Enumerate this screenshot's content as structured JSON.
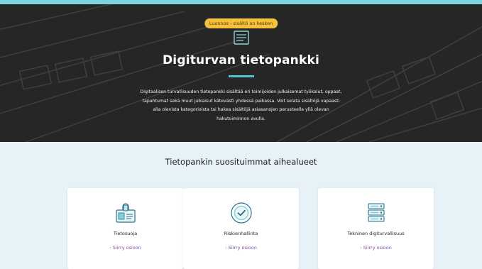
{
  "hero": {
    "badge": "Luonnos - sisältö on kesken",
    "title": "Digiturvan tietopankki",
    "description": "Digitaalisen turvallisuuden tietopankki sisältää eri toimijoiden julkaisemat työkalut, oppaat, tapahtumat sekä muut julkaisut kätevästi yhdessä paikassa. Voit selata sisältöjä vapaasti alla olevista kategorioista tai hakea sisältöjä asiasanojen perusteella yllä olevan hakutoiminnon avulla.",
    "icon": "book-icon"
  },
  "section": {
    "title": "Tietopankin suosituimmat aihealueet"
  },
  "cards": [
    {
      "title": "Tietosuoja",
      "link": "Siirry osioon",
      "icon": "id-card-lock-icon"
    },
    {
      "title": "Riskienhallinta",
      "link": "Siirry osioon",
      "icon": "shield-check-icon"
    },
    {
      "title": "Tekninen digiturvallisuus",
      "link": "Siirry osioon",
      "icon": "server-rack-icon"
    }
  ],
  "colors": {
    "accent": "#58c3cd",
    "badge": "#f5c13d",
    "link": "#7a4fa3",
    "chevron": "#e07b2a"
  }
}
